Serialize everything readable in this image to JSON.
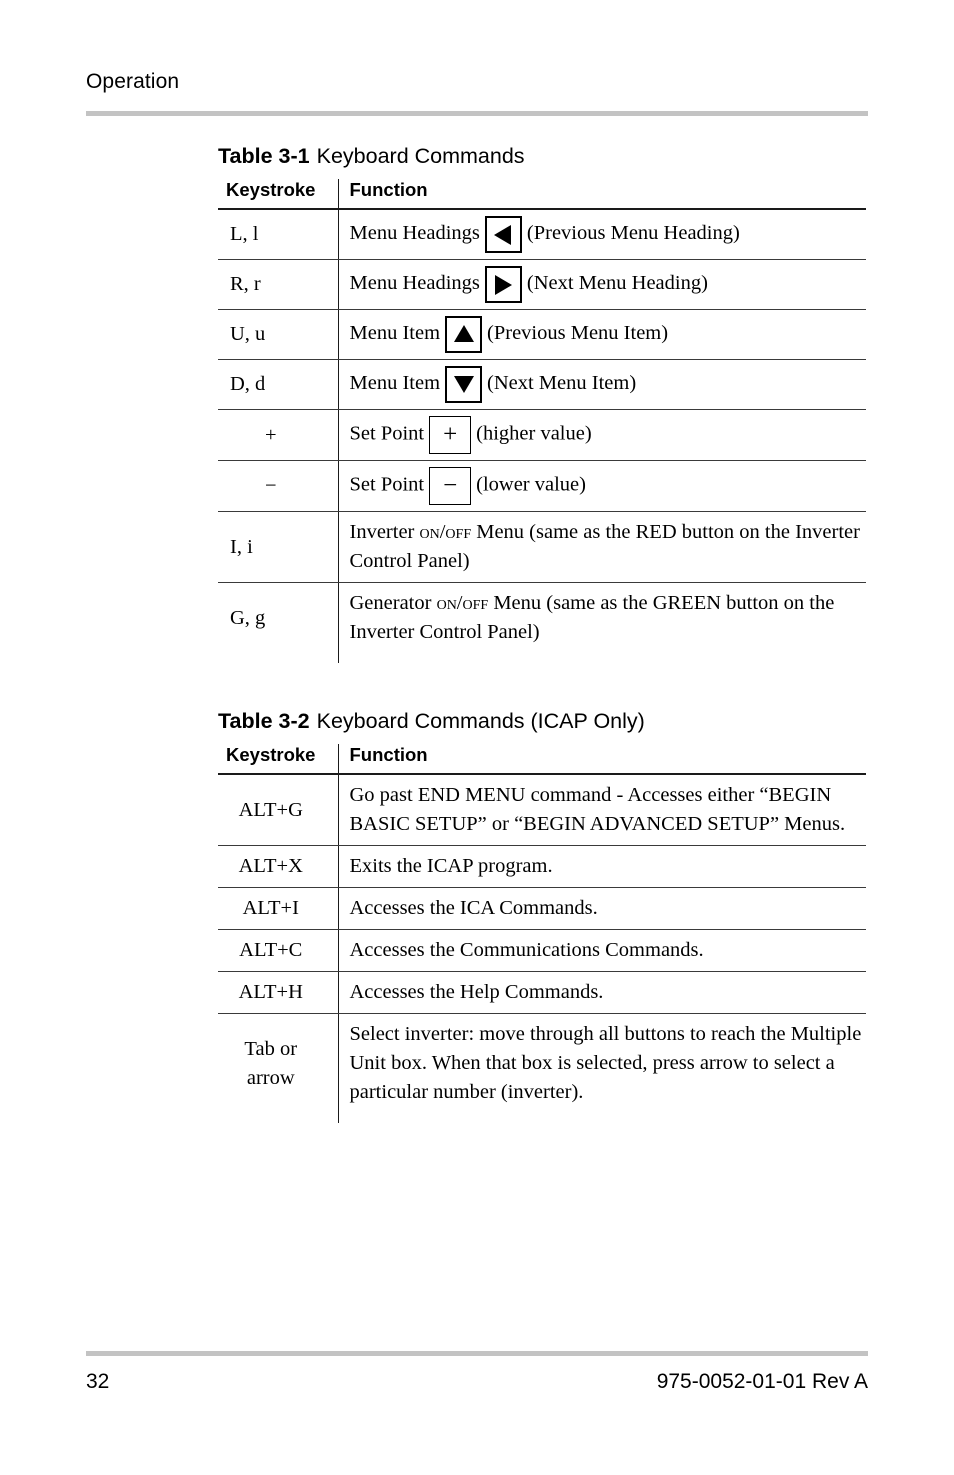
{
  "page": {
    "running_head": "Operation",
    "page_number": "32",
    "document_reference": "975-0052-01-01 Rev A",
    "rule_color": "#c3c3c3"
  },
  "table_one": {
    "caption_number": "Table 3-1",
    "caption_title": "Keyboard Commands",
    "columns": {
      "keystroke": "Keystroke",
      "function": "Function"
    },
    "rows": [
      {
        "keystroke": "L, l",
        "fn_before": "Menu Headings",
        "icon": "arrow-left-icon",
        "fn_after": "(Previous Menu Heading)"
      },
      {
        "keystroke": "R, r",
        "fn_before": "Menu Headings",
        "icon": "arrow-right-icon",
        "fn_after": "(Next Menu Heading)"
      },
      {
        "keystroke": "U, u",
        "fn_before": "Menu Item",
        "icon": "arrow-up-icon",
        "fn_after": "(Previous Menu Item)"
      },
      {
        "keystroke": "D, d",
        "fn_before": "Menu Item",
        "icon": "arrow-down-icon",
        "fn_after": "(Next Menu Item)"
      },
      {
        "keystroke": "+",
        "fn_before": "Set Point",
        "icon": "plus-icon",
        "icon_glyph": "+",
        "fn_after": "(higher value)"
      },
      {
        "keystroke": "−",
        "fn_before": "Set Point",
        "icon": "minus-icon",
        "icon_glyph": "−",
        "fn_after": "(lower value)"
      },
      {
        "keystroke": "I, i",
        "fn_lead": "Inverter ",
        "fn_smallcaps": "ON/OFF",
        "fn_tail": " Menu (same as the RED button on the Inverter Control Panel)"
      },
      {
        "keystroke": "G, g",
        "fn_lead": "Generator ",
        "fn_smallcaps": "ON/OFF",
        "fn_tail": " Menu (same as the GREEN button on the Inverter Control Panel)"
      }
    ]
  },
  "table_two": {
    "caption_number": "Table 3-2",
    "caption_title": "Keyboard Commands (ICAP Only)",
    "columns": {
      "keystroke": "Keystroke",
      "function": "Function"
    },
    "rows": [
      {
        "keystroke": "ALT+G",
        "function": "Go past END MENU command - Accesses either “BEGIN BASIC SETUP” or “BEGIN ADVANCED SETUP” Menus."
      },
      {
        "keystroke": "ALT+X",
        "function": "Exits the ICAP program."
      },
      {
        "keystroke": "ALT+I",
        "function": "Accesses the ICA Commands."
      },
      {
        "keystroke": "ALT+C",
        "function": "Accesses the Communications Commands."
      },
      {
        "keystroke": "ALT+H",
        "function": "Accesses the Help Commands."
      },
      {
        "keystroke": "Tab or arrow",
        "function": "Select inverter: move through all buttons to reach the Multiple Unit box. When that box is selected, press arrow to select a particular number (inverter)."
      }
    ]
  }
}
